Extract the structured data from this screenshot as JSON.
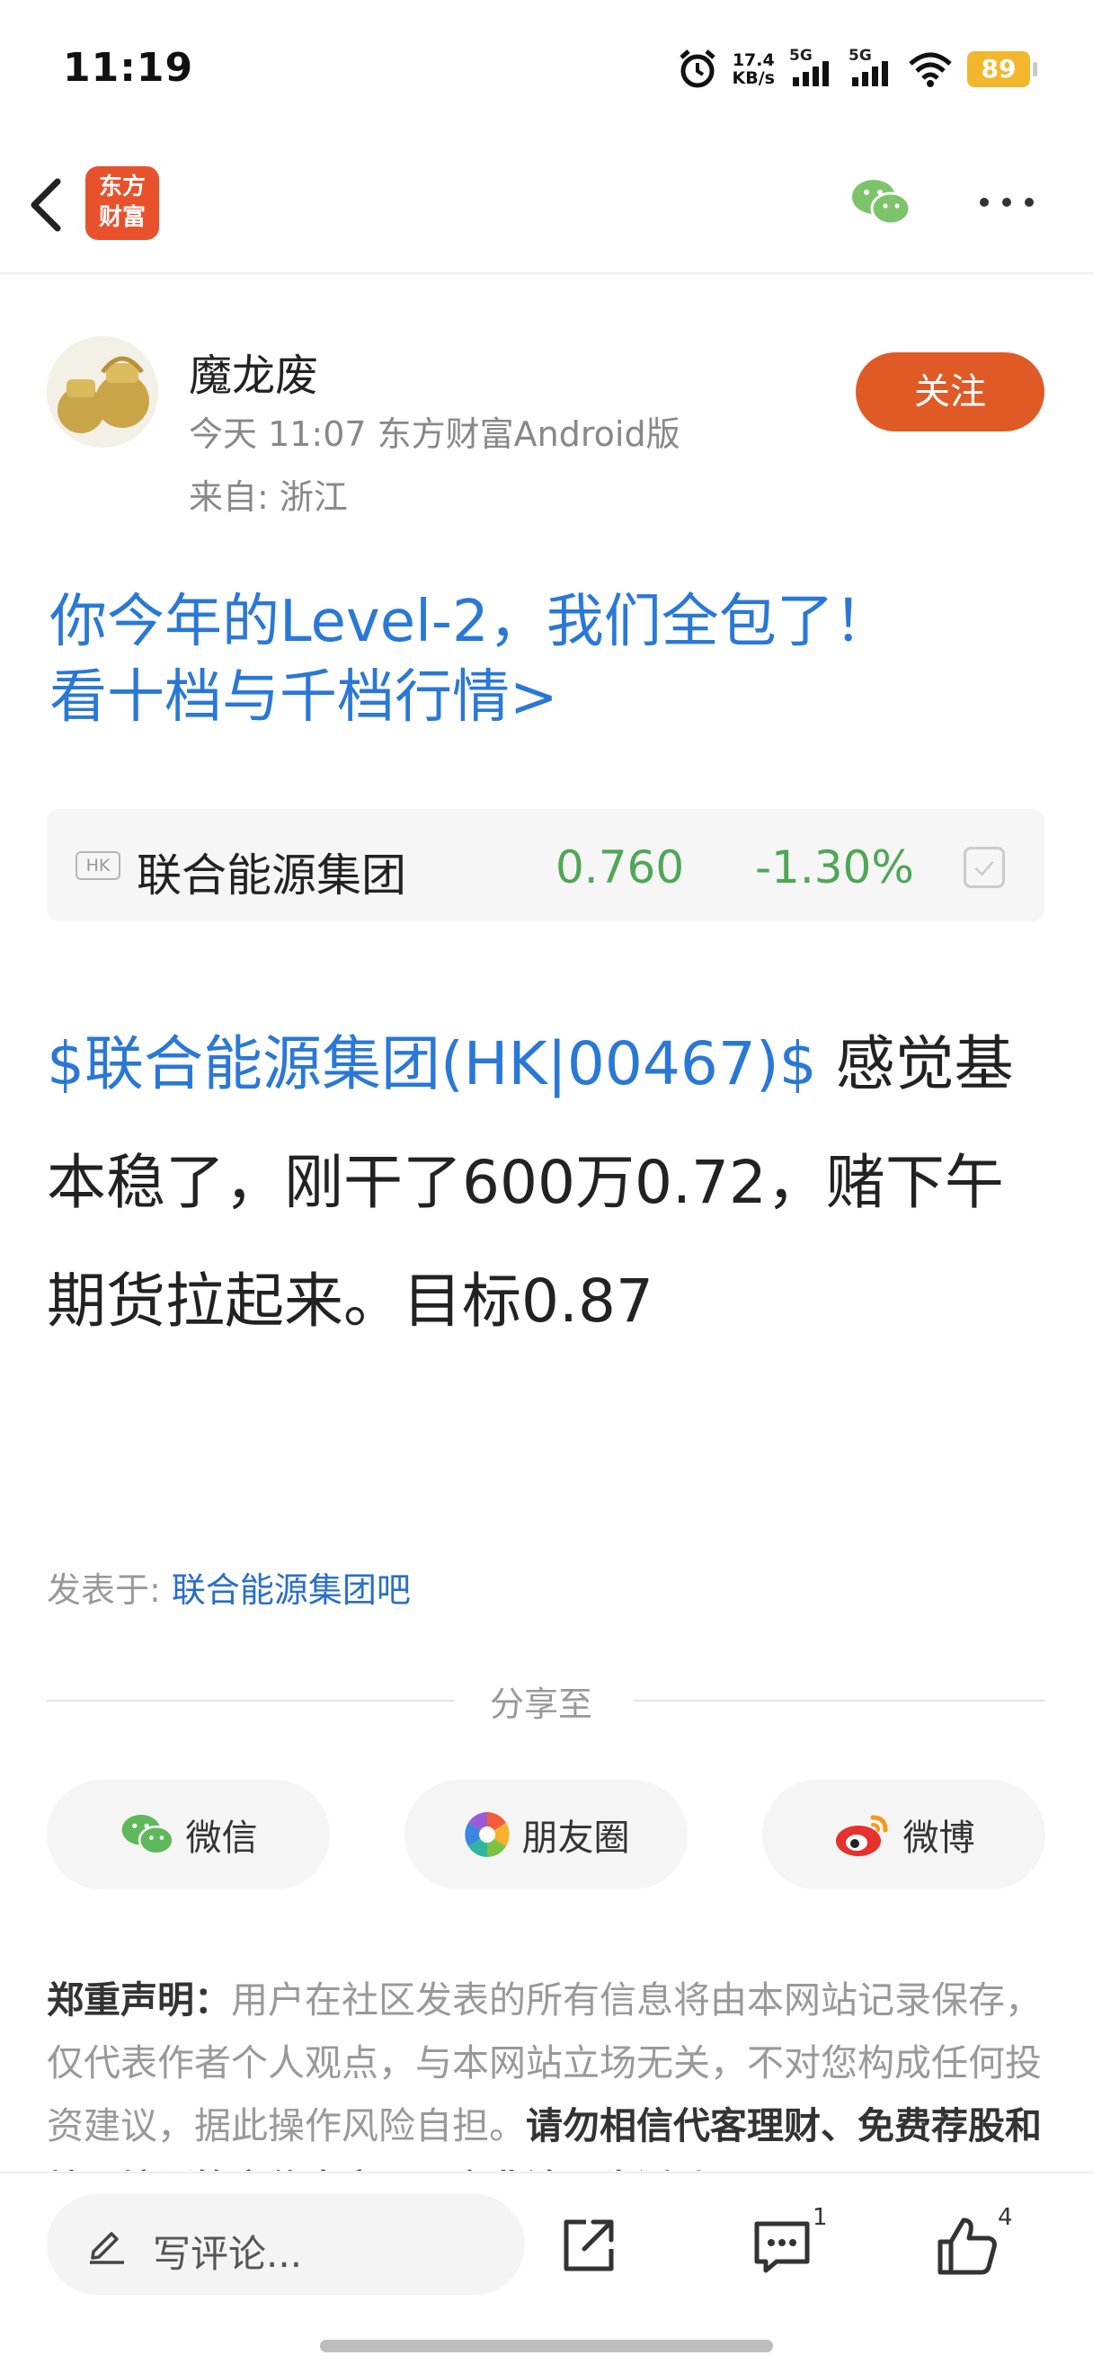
{
  "status_bar": {
    "time": "11:19",
    "net_speed_value": "17.4",
    "net_speed_unit": "KB/s",
    "sim1": "5G",
    "sim2": "5G",
    "battery": "89"
  },
  "nav": {
    "logo_line1": "东方",
    "logo_line2": "财富"
  },
  "author": {
    "name": "魔龙废",
    "meta": "今天 11:07 东方财富Android版",
    "location": "来自: 浙江",
    "follow_label": "关注"
  },
  "promo": {
    "line1": "你今年的Level-2，我们全包了！",
    "line2": "看十档与千档行情>"
  },
  "stock": {
    "market": "HK",
    "name": "联合能源集团",
    "price": "0.760",
    "change": "-1.30%",
    "change_color": "#4fa657"
  },
  "post": {
    "tag": "$联合能源集团(HK|00467)$",
    "text": " 感觉基本稳了，刚干了600万0.72，赌下午期货拉起来。目标0.87"
  },
  "posted_in": {
    "label": "发表于: ",
    "forum": "联合能源集团吧"
  },
  "share": {
    "title": "分享至",
    "buttons": [
      {
        "label": "微信",
        "icon": "wechat-icon"
      },
      {
        "label": "朋友圈",
        "icon": "moments-icon"
      },
      {
        "label": "微博",
        "icon": "weibo-icon"
      }
    ]
  },
  "disclaimer": {
    "heading": "郑重声明：",
    "body": "用户在社区发表的所有信息将由本网站记录保存，仅代表作者个人观点，与本网站立场无关，不对您构成任何投资建议，据此操作风险自担。",
    "strong": "请勿相信代客理财、免费荐股和炒股培训等宣传内容，远离非法证券活动。"
  },
  "bottom_bar": {
    "comment_placeholder": "写评论...",
    "comment_count": "1",
    "like_count": "4"
  },
  "colors": {
    "accent_blue": "#2a78d6",
    "follow_orange": "#e05a26",
    "stock_green": "#4fa657"
  }
}
